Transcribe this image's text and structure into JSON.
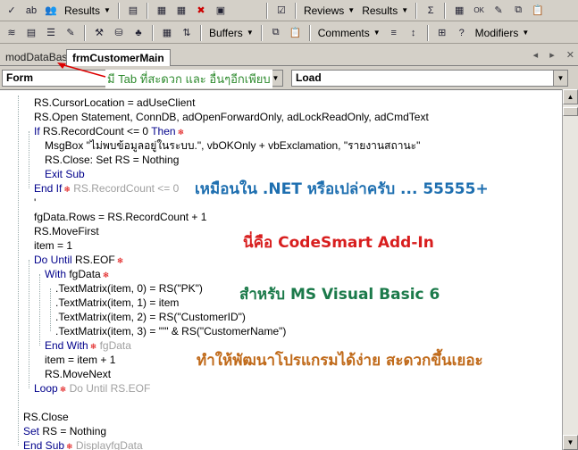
{
  "toolbar1": {
    "results_label": "Results",
    "reviews_label": "Reviews",
    "results2_label": "Results"
  },
  "toolbar2": {
    "buffers_label": "Buffers",
    "comments_label": "Comments",
    "modifiers_label": "Modifiers"
  },
  "tabs": [
    {
      "label": "modDataBase"
    },
    {
      "label": "frmCustomerMain"
    }
  ],
  "combos": {
    "object": "Form",
    "procedure": "Load"
  },
  "tip": "มี Tab ที่สะดวก และ อื่นๆอีกเพียบ",
  "code": [
    {
      "text": "RS.CursorLocation = adUseClient",
      "indent": 38
    },
    {
      "text": "RS.Open Statement, ConnDB, adOpenForwardOnly, adLockReadOnly, adCmdText",
      "indent": 38
    },
    {
      "kw": "If ",
      "text": "RS.RecordCount <= 0 ",
      "kw2": "Then",
      "mark": "❄",
      "indent": 38
    },
    {
      "text": "MsgBox \"ไม่พบข้อมูลอยู่ในระบบ.\", vbOKOnly + vbExclamation, \"รายงานสถานะ\"",
      "indent": 50
    },
    {
      "text": "RS.Close:   Set RS = Nothing",
      "indent": 50
    },
    {
      "kw": "Exit Sub",
      "text": "",
      "indent": 50
    },
    {
      "kw": "End If",
      "text": "",
      "mark": "❄",
      "cm": "RS.RecordCount <= 0",
      "indent": 38
    },
    {
      "text": "'",
      "indent": 38
    },
    {
      "text": "fgData.Rows = RS.RecordCount + 1",
      "indent": 38
    },
    {
      "text": "RS.MoveFirst",
      "indent": 38
    },
    {
      "text": "item = 1",
      "indent": 38
    },
    {
      "kw": "Do Until ",
      "text": "RS.EOF",
      "mark": "❄",
      "indent": 38
    },
    {
      "kw": "With ",
      "text": "fgData",
      "mark": "❄",
      "indent": 50
    },
    {
      "text": ".TextMatrix(item, 0) = RS(\"PK\")",
      "indent": 62
    },
    {
      "text": ".TextMatrix(item, 1) = item",
      "indent": 62
    },
    {
      "text": ".TextMatrix(item, 2) = RS(\"CustomerID\")",
      "indent": 62
    },
    {
      "text": ".TextMatrix(item, 3) = \"'\" & RS(\"CustomerName\")",
      "indent": 62
    },
    {
      "kw": "End With",
      "text": "",
      "mark": "❄",
      "cm": "fgData",
      "indent": 50
    },
    {
      "text": "item = item + 1",
      "indent": 50
    },
    {
      "text": "RS.MoveNext",
      "indent": 50
    },
    {
      "kw": "Loop",
      "text": "",
      "mark": "❄",
      "cm": "Do Until RS.EOF",
      "indent": 38
    },
    {
      "text": "",
      "indent": 38
    },
    {
      "text": "RS.Close",
      "indent": 26
    },
    {
      "kw": "Set ",
      "text": "RS = Nothing",
      "indent": 26
    },
    {
      "kw": "End Sub",
      "text": "",
      "mark": "❄",
      "cm": "DisplayfgData",
      "indent": 26
    }
  ],
  "annotations": {
    "a1": "เหมือนใน .NET หรือเปล่าครับ ... 55555+",
    "a2": "นี่คือ CodeSmart Add-In",
    "a3": "สำหรับ MS Visual Basic 6",
    "a4": "ทำให้พัฒนาโปรแกรมได้ง่าย สะดวกขึ้นเยอะ"
  }
}
